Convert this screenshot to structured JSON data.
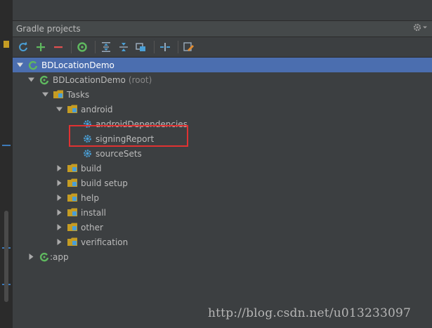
{
  "panel": {
    "title": "Gradle projects"
  },
  "icons": {
    "gear": "gear-icon",
    "refresh": "refresh-icon",
    "add": "add-icon",
    "remove": "remove-icon",
    "run": "execute-task-icon",
    "expand": "expand-all-icon",
    "collapse": "collapse-all-icon",
    "link": "link-icon",
    "offline": "offline-icon",
    "settings": "gradle-settings-icon"
  },
  "tree": {
    "root": "BDLocationDemo",
    "project": "BDLocationDemo",
    "project_suffix": "(root)",
    "tasks": "Tasks",
    "android": "android",
    "android_dependencies": "androidDependencies",
    "signing_report": "signingReport",
    "source_sets": "sourceSets",
    "build": "build",
    "build_setup": "build setup",
    "help": "help",
    "install": "install",
    "other": "other",
    "verification": "verification",
    "app": ":app"
  },
  "watermark": "http://blog.csdn.net/u013233097",
  "colors": {
    "background": "#3c3f41",
    "selection": "#4b6eaf",
    "highlight_box": "#e03232",
    "gradle_green": "#5fb85f",
    "folder": "#c59c23",
    "gear_blue": "#4a9fd6"
  }
}
